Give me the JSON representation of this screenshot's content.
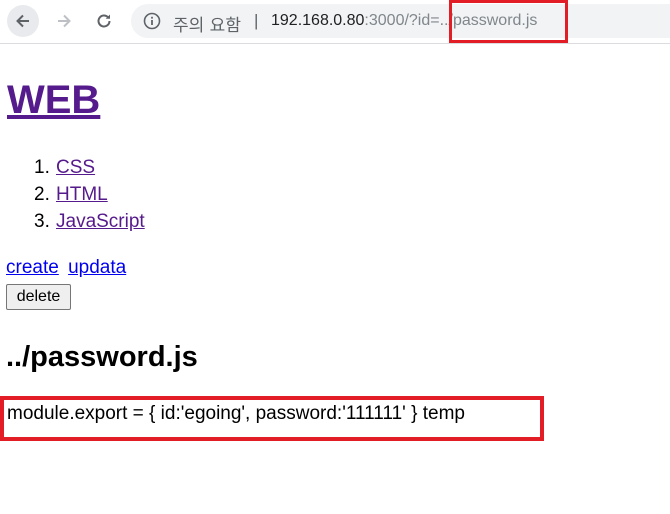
{
  "browser": {
    "security_label": "주의 요함",
    "separator": "|",
    "url_host": "192.168.0.80",
    "url_rest": ":3000/?id=../password.js"
  },
  "page": {
    "title": "WEB",
    "topics": [
      {
        "num": "1.",
        "label": "CSS"
      },
      {
        "num": "2.",
        "label": "HTML"
      },
      {
        "num": "3.",
        "label": "JavaScript"
      }
    ],
    "create_label": "create",
    "update_label": "updata",
    "delete_label": "delete",
    "doc_title": "../password.js",
    "doc_body": "module.export = { id:'egoing', password:'111111' } temp"
  },
  "colors": {
    "highlight": "#e31d26",
    "visited_link": "#551a8b",
    "link": "#0000ee"
  },
  "icons": [
    "back-arrow-icon",
    "forward-arrow-icon",
    "reload-icon",
    "info-icon"
  ]
}
